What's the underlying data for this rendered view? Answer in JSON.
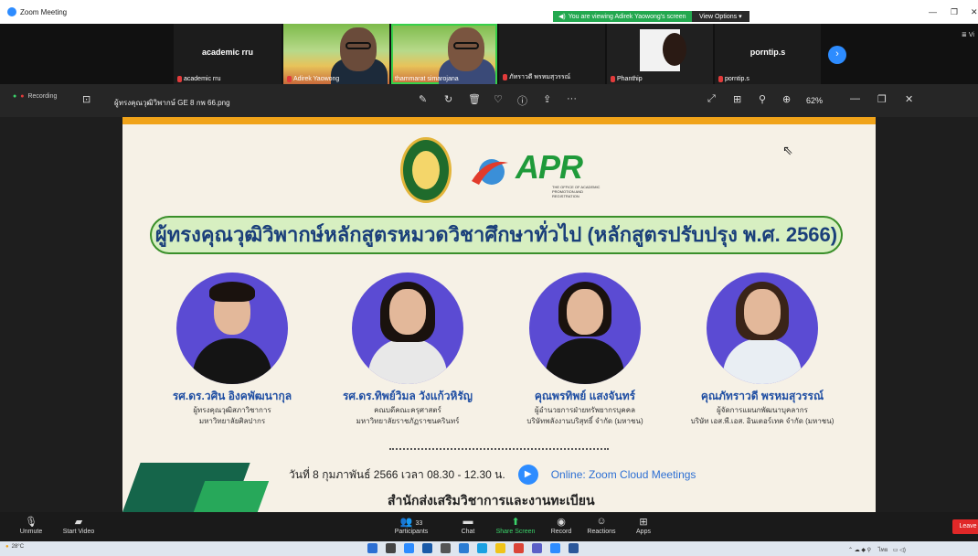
{
  "window": {
    "title": "Zoom Meeting",
    "viewing_banner": "You are viewing Adirek Yaowong's screen",
    "view_options": "View Options",
    "view_btn": "Vi"
  },
  "participants": [
    {
      "name": "academic rru",
      "label": "academic rru"
    },
    {
      "name": "",
      "label": "Adirek Yaowong"
    },
    {
      "name": "",
      "label": "thammarat simarojana"
    },
    {
      "name": "",
      "label": "ภัทราวดี พรหมสุวรรณ์"
    },
    {
      "name": "",
      "label": "Phanthip"
    },
    {
      "name": "porntip.s",
      "label": "porntip.s"
    }
  ],
  "viewer": {
    "recording": "Recording",
    "filename": "ผู้ทรงคุณวุฒิวิพากษ์ GE 8 กพ 66.png",
    "zoom": "62%"
  },
  "slide": {
    "brand": "APR",
    "brand_sub": "THE OFFICE OF ACADEMIC PROMOTION AND REGISTRATION",
    "headline": "ผู้ทรงคุณวุฒิวิพากษ์หลักสูตรหมวดวิชาศึกษาทั่วไป (หลักสูตรปรับปรุง พ.ศ. 2566)",
    "people": [
      {
        "name": "รศ.ดร.วศิน อิงคพัฒนากุล",
        "role1": "ผู้ทรงคุณวุฒิสภาวิชาการ",
        "role2": "มหาวิทยาลัยศิลปากร"
      },
      {
        "name": "รศ.ดร.ทิพย์วิมล วังแก้วหิรัญ",
        "role1": "คณบดีคณะครุศาสตร์",
        "role2": "มหาวิทยาลัยราชภัฏราชนครินทร์"
      },
      {
        "name": "คุณพรทิพย์ แสงจันทร์",
        "role1": "ผู้อำนวยการฝ่ายทรัพยากรบุคคล",
        "role2": "บริษัทพลังงานบริสุทธิ์ จำกัด (มหาชน)"
      },
      {
        "name": "คุณภัทราวดี พรหมสุวรรณ์",
        "role1": "ผู้จัดการแผนกพัฒนาบุคลากร",
        "role2": "บริษัท เอส.พี.เอส. อินเตอร์เทค จำกัด (มหาชน)"
      }
    ],
    "date_text": "วันที่ 8 กุมภาพันธ์ 2566 เวลา 08.30 - 12.30 น.",
    "online_text": "Online: Zoom Cloud Meetings",
    "office_text": "สำนักส่งเสริมวิชาการและงานทะเบียน"
  },
  "toolbar": {
    "unmute": "Unmute",
    "start_video": "Start Video",
    "participants": "Participants",
    "participants_count": "33",
    "chat": "Chat",
    "share": "Share Screen",
    "record": "Record",
    "reactions": "Reactions",
    "apps": "Apps",
    "leave": "Leave"
  },
  "taskbar": {
    "weather": "28°C",
    "lang": "ไทย"
  }
}
